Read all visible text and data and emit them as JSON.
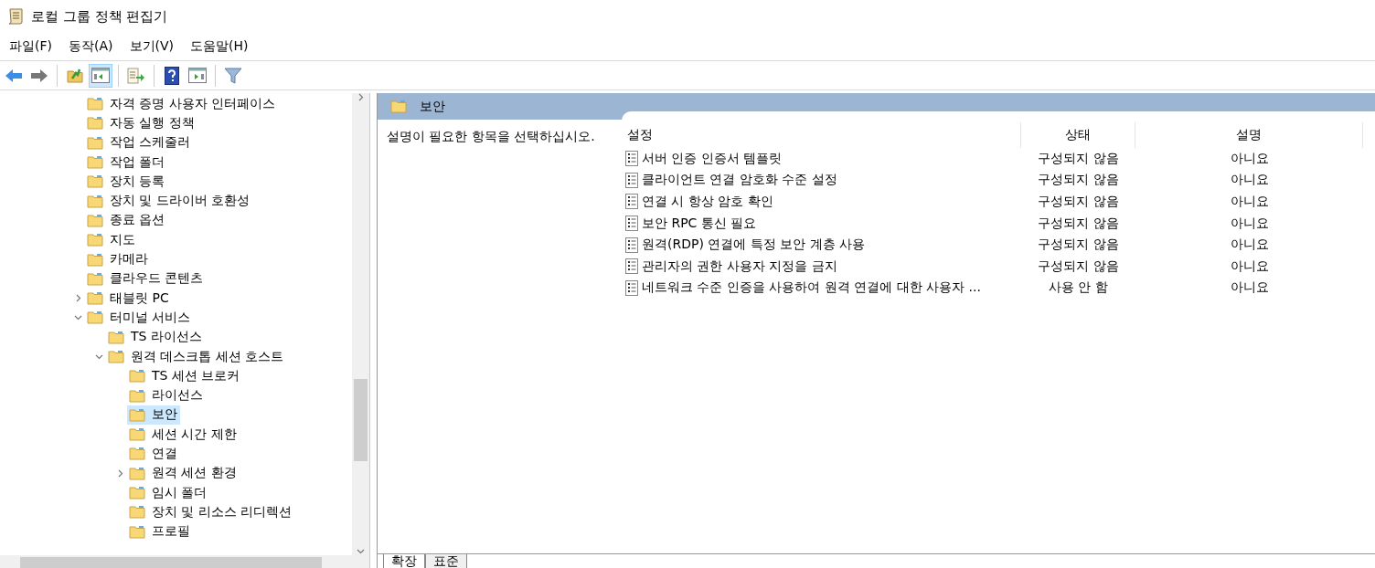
{
  "window": {
    "title": "로컬 그룹 정책 편집기"
  },
  "menu": [
    "파일(F)",
    "동작(A)",
    "보기(V)",
    "도움말(H)"
  ],
  "toolbar": [
    {
      "kind": "back",
      "pressed": false
    },
    {
      "kind": "forward",
      "pressed": false
    },
    {
      "kind": "sep"
    },
    {
      "kind": "up",
      "pressed": false
    },
    {
      "kind": "tree",
      "pressed": true
    },
    {
      "kind": "sep"
    },
    {
      "kind": "export",
      "pressed": false
    },
    {
      "kind": "sep"
    },
    {
      "kind": "help",
      "pressed": false
    },
    {
      "kind": "panel",
      "pressed": false
    },
    {
      "kind": "sep"
    },
    {
      "kind": "filter",
      "pressed": false
    }
  ],
  "tree": [
    {
      "label": "자격 증명 사용자 인터페이스",
      "selected": false
    },
    {
      "label": "자동 실행 정책",
      "selected": false
    },
    {
      "label": "작업 스케줄러",
      "selected": false
    },
    {
      "label": "작업 폴더",
      "selected": false
    },
    {
      "label": "장치 등록",
      "selected": false
    },
    {
      "label": "장치 및 드라이버 호환성",
      "selected": false
    },
    {
      "label": "종료 옵션",
      "selected": false
    },
    {
      "label": "지도",
      "selected": false
    },
    {
      "label": "카메라",
      "selected": false
    },
    {
      "label": "클라우드 콘텐츠",
      "selected": false
    },
    {
      "label": "태블릿 PC",
      "selected": false,
      "expanded": false
    },
    {
      "label": "터미널 서비스",
      "selected": false,
      "expanded": true,
      "children": [
        {
          "label": "TS 라이선스",
          "selected": false
        },
        {
          "label": "원격 데스크톱 세션 호스트",
          "selected": false,
          "expanded": true,
          "children": [
            {
              "label": "TS 세션 브로커",
              "selected": false
            },
            {
              "label": "라이선스",
              "selected": false
            },
            {
              "label": "보안",
              "selected": true
            },
            {
              "label": "세션 시간 제한",
              "selected": false
            },
            {
              "label": "연결",
              "selected": false
            },
            {
              "label": "원격 세션 환경",
              "selected": false,
              "expanded": false
            },
            {
              "label": "임시 폴더",
              "selected": false
            },
            {
              "label": "장치 및 리소스 리디렉션",
              "selected": false
            },
            {
              "label": "프로필",
              "selected": false
            }
          ]
        }
      ]
    }
  ],
  "details": {
    "header": "보안",
    "description": "설명이 필요한 항목을 선택하십시오.",
    "columns": [
      "설정",
      "상태",
      "설명"
    ],
    "rows": [
      {
        "setting": "서버 인증 인증서 템플릿",
        "state": "구성되지 않음",
        "comment": "아니요"
      },
      {
        "setting": "클라이언트 연결 암호화 수준 설정",
        "state": "구성되지 않음",
        "comment": "아니요"
      },
      {
        "setting": "연결 시 항상 암호 확인",
        "state": "구성되지 않음",
        "comment": "아니요"
      },
      {
        "setting": "보안 RPC 통신 필요",
        "state": "구성되지 않음",
        "comment": "아니요"
      },
      {
        "setting": "원격(RDP) 연결에 특정 보안 계층 사용",
        "state": "구성되지 않음",
        "comment": "아니요"
      },
      {
        "setting": "관리자의 권한 사용자 지정을 금지",
        "state": "구성되지 않음",
        "comment": "아니요"
      },
      {
        "setting": "네트워크 수준 인증을 사용하여 원격 연결에 대한 사용자 ...",
        "state": "사용 안 함",
        "comment": "아니요"
      }
    ],
    "tabs": [
      {
        "label": "확장",
        "selected": true
      },
      {
        "label": "표준",
        "selected": false
      }
    ]
  }
}
